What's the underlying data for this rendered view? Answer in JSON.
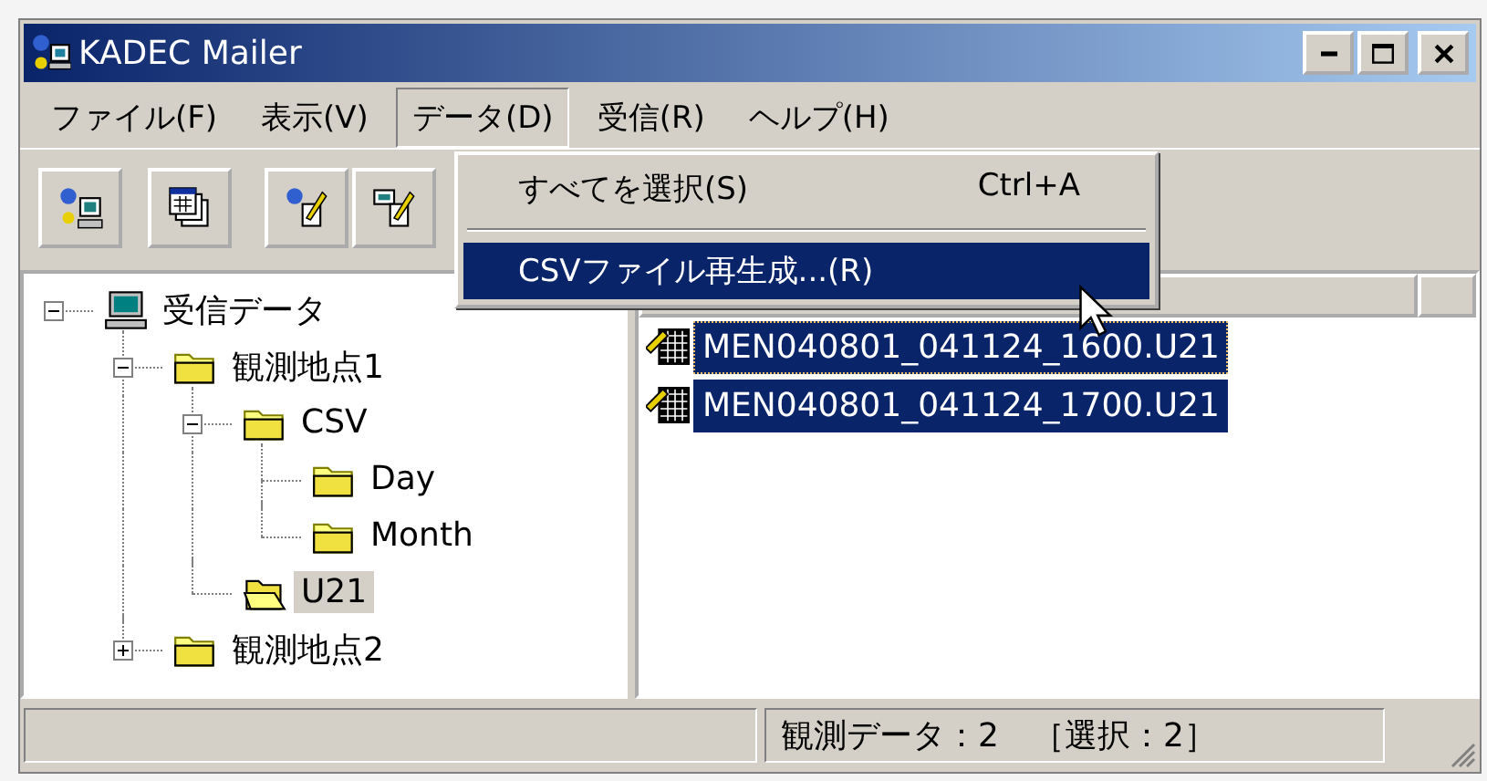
{
  "window": {
    "title": "KADEC Mailer"
  },
  "menubar": [
    {
      "label": "ファイル(F)",
      "selected": false
    },
    {
      "label": "表示(V)",
      "selected": false
    },
    {
      "label": "データ(D)",
      "selected": true
    },
    {
      "label": "受信(R)",
      "selected": false
    },
    {
      "label": "ヘルプ(H)",
      "selected": false
    }
  ],
  "menu": [
    {
      "kind": "item",
      "label": "すべてを選択(S)",
      "shortcut": "Ctrl+A",
      "selected": false
    },
    {
      "kind": "separator"
    },
    {
      "kind": "item",
      "label": "CSVファイル再生成...(R)",
      "selected": true
    }
  ],
  "tree": [
    {
      "label": "受信データ",
      "kind": "computer",
      "expanded": true,
      "selected": false,
      "children": [
        {
          "label": "観測地点1",
          "kind": "folder",
          "expanded": true,
          "selected": false,
          "children": [
            {
              "label": "CSV",
              "kind": "folder",
              "expanded": true,
              "selected": false,
              "children": [
                {
                  "label": "Day",
                  "kind": "folder",
                  "selected": false
                },
                {
                  "label": "Month",
                  "kind": "folder",
                  "selected": false
                }
              ]
            },
            {
              "label": "U21",
              "kind": "open-folder",
              "selected": true
            }
          ]
        },
        {
          "label": "観測地点2",
          "kind": "folder",
          "expanded": false,
          "selected": false
        }
      ]
    }
  ],
  "files": [
    {
      "name": "MEN040801_041124_1600.U21",
      "selected": true,
      "focused": true
    },
    {
      "name": "MEN040801_041124_1700.U21",
      "selected": true,
      "focused": false
    }
  ],
  "status_bar": {
    "text": "観測データ：2　［選択：2］"
  }
}
